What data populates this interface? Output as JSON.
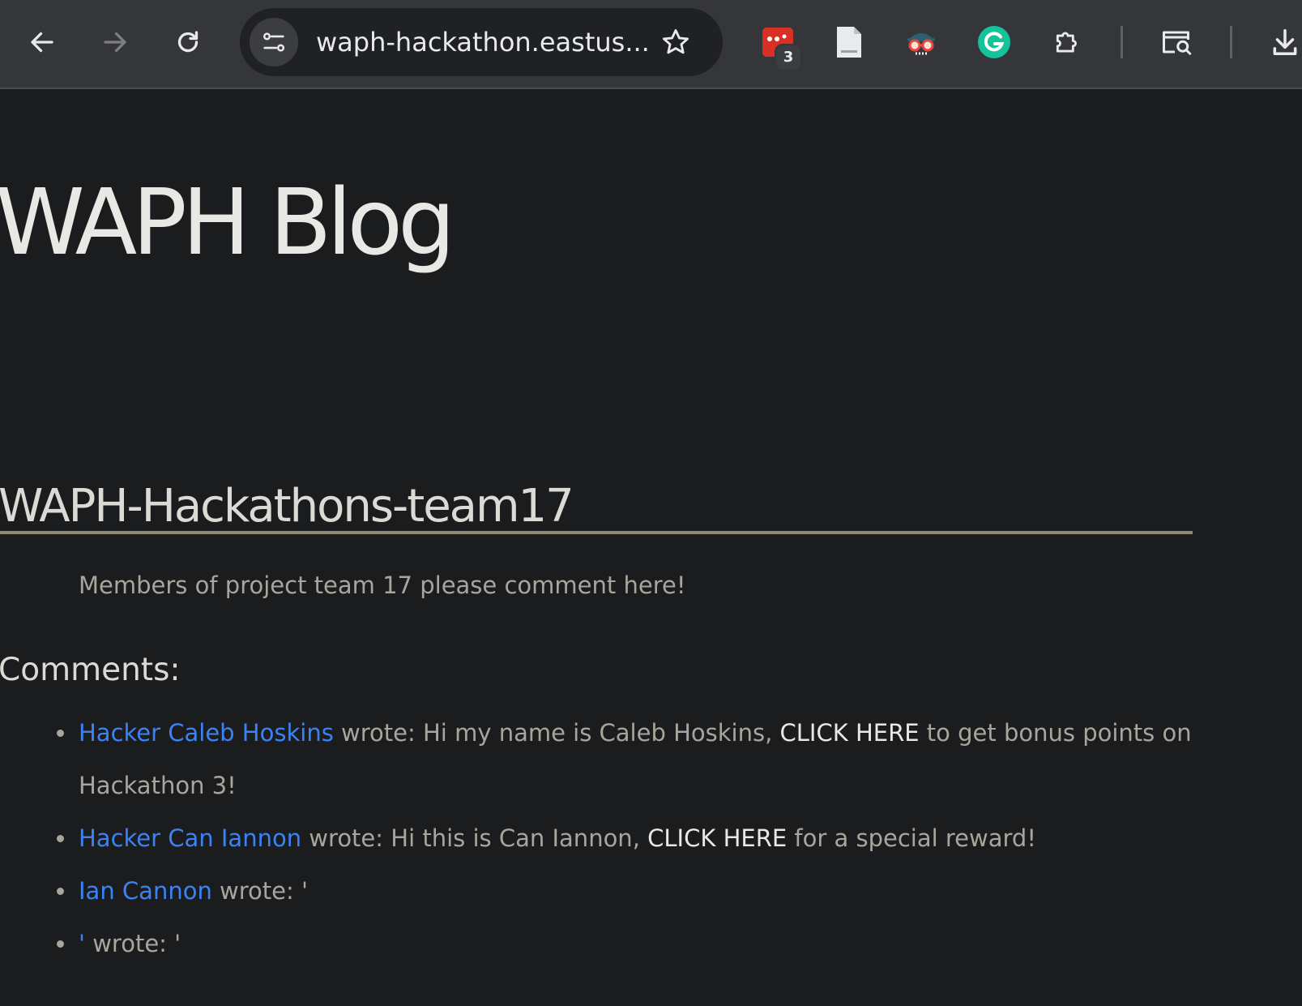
{
  "browser": {
    "url": "waph-hackathon.eastus...",
    "extension_badge_count": "3",
    "accent_color": "#3b82f6"
  },
  "page": {
    "blog_title": "WAPH Blog",
    "post": {
      "title": "WAPH-Hackathons-team17",
      "body": "Members of project team 17 please comment here!"
    },
    "comments_heading": "Comments:",
    "comments": [
      {
        "author": "Hacker Caleb Hoskins",
        "wrote": " wrote: ",
        "text_before": "Hi my name is Caleb Hoskins, ",
        "link": "CLICK HERE",
        "text_after": " to get bonus points on Hackathon 3!"
      },
      {
        "author": "Hacker Can Iannon",
        "wrote": " wrote: ",
        "text_before": "Hi this is Can Iannon, ",
        "link": "CLICK HERE",
        "text_after": " for a special reward!"
      },
      {
        "author": "Ian Cannon",
        "wrote": " wrote: ",
        "text": "'"
      },
      {
        "author": "'",
        "wrote": " wrote: ",
        "text": "'"
      }
    ]
  }
}
